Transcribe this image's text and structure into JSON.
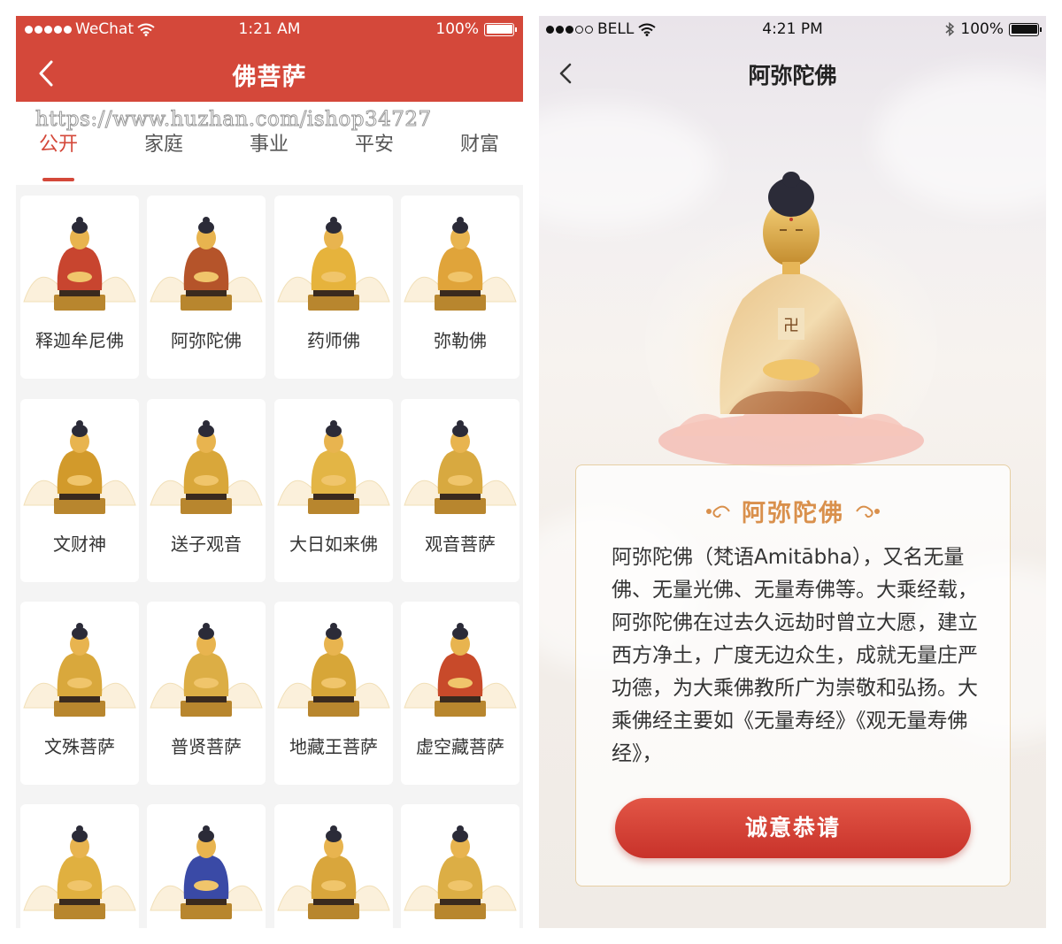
{
  "left": {
    "status": {
      "carrier": "WeChat",
      "time": "1:21 AM",
      "battery": "100%"
    },
    "title": "佛菩萨",
    "watermark": "https://www.huzhan.com/ishop34727",
    "tabs": [
      {
        "label": "公开",
        "active": true
      },
      {
        "label": "家庭",
        "active": false
      },
      {
        "label": "事业",
        "active": false
      },
      {
        "label": "平安",
        "active": false
      },
      {
        "label": "财富",
        "active": false
      }
    ],
    "deities": [
      {
        "name": "释迦牟尼佛",
        "robe": "#c8452f"
      },
      {
        "name": "阿弥陀佛",
        "robe": "#b5542a"
      },
      {
        "name": "药师佛",
        "robe": "#e6b33c"
      },
      {
        "name": "弥勒佛",
        "robe": "#e0a43a"
      },
      {
        "name": "文财神",
        "robe": "#d29a2b"
      },
      {
        "name": "送子观音",
        "robe": "#d9a73a"
      },
      {
        "name": "大日如来佛",
        "robe": "#e3b545"
      },
      {
        "name": "观音菩萨",
        "robe": "#d8a940"
      },
      {
        "name": "文殊菩萨",
        "robe": "#d9a83c"
      },
      {
        "name": "普贤菩萨",
        "robe": "#dcae45"
      },
      {
        "name": "地藏王菩萨",
        "robe": "#d7a638"
      },
      {
        "name": "虚空藏菩萨",
        "robe": "#c84a2a"
      },
      {
        "name": "",
        "robe": "#e0b040"
      },
      {
        "name": "",
        "robe": "#3a4aa6"
      },
      {
        "name": "",
        "robe": "#d9a63c"
      },
      {
        "name": "",
        "robe": "#dcae45"
      }
    ]
  },
  "right": {
    "status": {
      "carrier": "BELL",
      "time": "4:21 PM",
      "battery": "100%"
    },
    "title": "阿弥陀佛",
    "card_title": "阿弥陀佛",
    "description": "阿弥陀佛（梵语Amitābha），又名无量佛、无量光佛、无量寿佛等。大乘经载，阿弥陀佛在过去久远劫时曾立大愿，建立西方净土，广度无边众生，成就无量庄严功德，为大乘佛教所广为崇敬和弘扬。大乘佛经主要如《无量寿经》《观无量寿佛经》，",
    "button": "诚意恭请"
  },
  "colors": {
    "primary_red": "#d4483a",
    "gold": "#d9904c",
    "card_border": "#e6cfa4"
  },
  "icons": {
    "back": "chevron-left-icon",
    "wifi": "wifi-icon",
    "bluetooth": "bluetooth-icon",
    "battery": "battery-icon",
    "lotus": "lotus-icon",
    "ornament": "ornament-icon"
  }
}
